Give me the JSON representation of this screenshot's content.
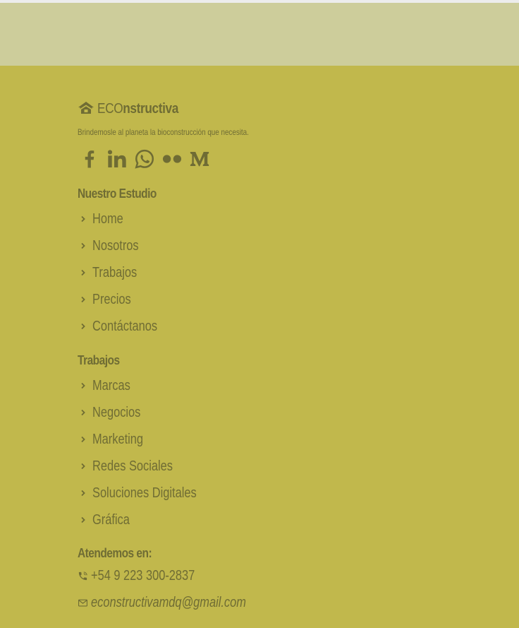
{
  "brand": {
    "icon": "house-icon",
    "name_light": "ECO",
    "name_bold": "nstructiva",
    "tagline": "Brindemosle al planeta la bioconstrucción que necesita."
  },
  "socials": [
    {
      "name": "facebook-icon"
    },
    {
      "name": "linkedin-icon"
    },
    {
      "name": "whatsapp-icon"
    },
    {
      "name": "flickr-icon"
    },
    {
      "name": "medium-icon"
    }
  ],
  "studio": {
    "title": "Nuestro Estudio",
    "items": [
      "Home",
      "Nosotros",
      "Trabajos",
      "Precios",
      "Contáctanos"
    ]
  },
  "works": {
    "title": "Trabajos",
    "items": [
      "Marcas",
      "Negocios",
      "Marketing",
      "Redes Sociales",
      "Soluciones Digitales",
      "Gráfica"
    ]
  },
  "contact": {
    "title": "Atendemos en:",
    "phone": "+54 9 223 300-2837",
    "email": "econstructivamdq@gmail.com"
  },
  "colors": {
    "footer_bg": "#c1b84c",
    "band_bg": "#cdcd9b",
    "text": "#6f6c34"
  }
}
